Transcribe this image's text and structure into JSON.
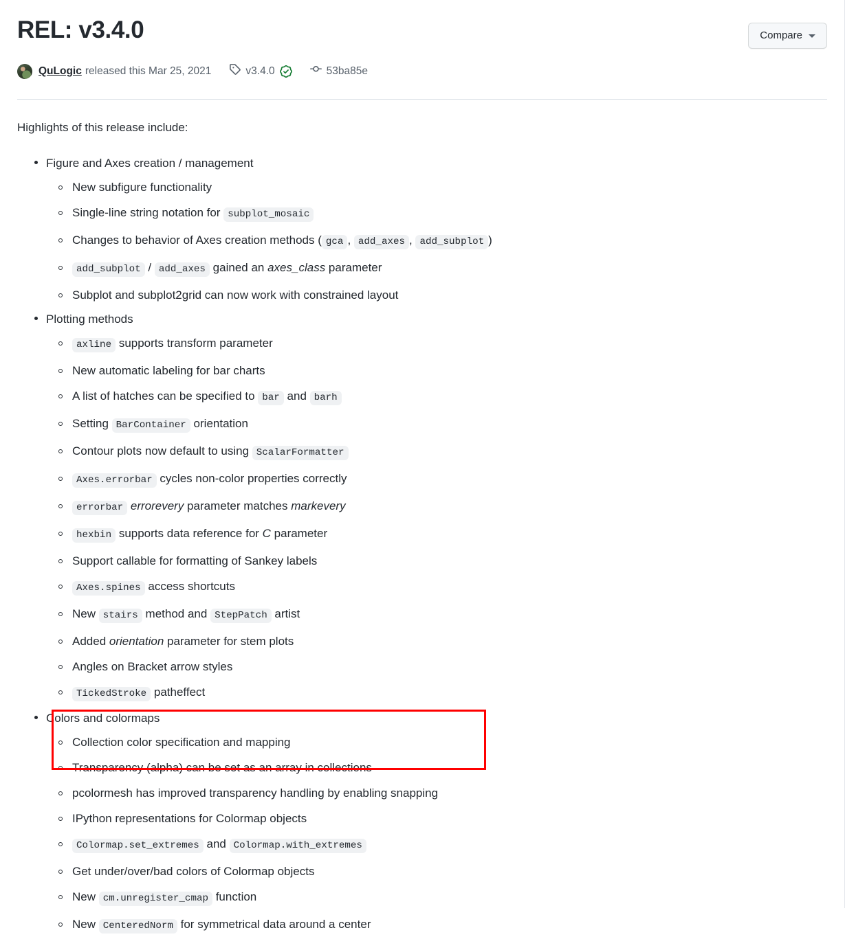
{
  "header": {
    "title": "REL: v3.4.0",
    "compare_label": "Compare",
    "caret_icon": "chevron-down-icon"
  },
  "meta": {
    "avatar_icon": "avatar",
    "author": "QuLogic",
    "released_text": "released this Mar 25, 2021",
    "tag_icon": "tag-icon",
    "tag": "v3.4.0",
    "verified_icon": "verified-badge-icon",
    "verified_color": "#1a7f37",
    "commit_icon": "git-commit-icon",
    "commit": "53ba85e"
  },
  "body": {
    "intro": "Highlights of this release include:",
    "groups": [
      {
        "title": "Figure and Axes creation / management",
        "highlighted": false,
        "items": [
          [
            {
              "t": "text",
              "v": "New subfigure functionality"
            }
          ],
          [
            {
              "t": "text",
              "v": "Single-line string notation for "
            },
            {
              "t": "code",
              "v": "subplot_mosaic"
            }
          ],
          [
            {
              "t": "text",
              "v": "Changes to behavior of Axes creation methods ("
            },
            {
              "t": "code",
              "v": "gca"
            },
            {
              "t": "text",
              "v": ", "
            },
            {
              "t": "code",
              "v": "add_axes"
            },
            {
              "t": "text",
              "v": ", "
            },
            {
              "t": "code",
              "v": "add_subplot"
            },
            {
              "t": "text",
              "v": ")"
            }
          ],
          [
            {
              "t": "code",
              "v": "add_subplot"
            },
            {
              "t": "text",
              "v": " / "
            },
            {
              "t": "code",
              "v": "add_axes"
            },
            {
              "t": "text",
              "v": " gained an "
            },
            {
              "t": "em",
              "v": "axes_class"
            },
            {
              "t": "text",
              "v": " parameter"
            }
          ],
          [
            {
              "t": "text",
              "v": "Subplot and subplot2grid can now work with constrained layout"
            }
          ]
        ]
      },
      {
        "title": "Plotting methods",
        "highlighted": false,
        "items": [
          [
            {
              "t": "code",
              "v": "axline"
            },
            {
              "t": "text",
              "v": " supports transform parameter"
            }
          ],
          [
            {
              "t": "text",
              "v": "New automatic labeling for bar charts"
            }
          ],
          [
            {
              "t": "text",
              "v": "A list of hatches can be specified to "
            },
            {
              "t": "code",
              "v": "bar"
            },
            {
              "t": "text",
              "v": " and "
            },
            {
              "t": "code",
              "v": "barh"
            }
          ],
          [
            {
              "t": "text",
              "v": "Setting "
            },
            {
              "t": "code",
              "v": "BarContainer"
            },
            {
              "t": "text",
              "v": " orientation"
            }
          ],
          [
            {
              "t": "text",
              "v": "Contour plots now default to using "
            },
            {
              "t": "code",
              "v": "ScalarFormatter"
            }
          ],
          [
            {
              "t": "code",
              "v": "Axes.errorbar"
            },
            {
              "t": "text",
              "v": " cycles non-color properties correctly"
            }
          ],
          [
            {
              "t": "code",
              "v": "errorbar"
            },
            {
              "t": "text",
              "v": " "
            },
            {
              "t": "em",
              "v": "errorevery"
            },
            {
              "t": "text",
              "v": " parameter matches "
            },
            {
              "t": "em",
              "v": "markevery"
            }
          ],
          [
            {
              "t": "code",
              "v": "hexbin"
            },
            {
              "t": "text",
              "v": " supports data reference for "
            },
            {
              "t": "em",
              "v": "C"
            },
            {
              "t": "text",
              "v": " parameter"
            }
          ],
          [
            {
              "t": "text",
              "v": "Support callable for formatting of Sankey labels"
            }
          ],
          [
            {
              "t": "code",
              "v": "Axes.spines"
            },
            {
              "t": "text",
              "v": " access shortcuts"
            }
          ],
          [
            {
              "t": "text",
              "v": "New "
            },
            {
              "t": "code",
              "v": "stairs"
            },
            {
              "t": "text",
              "v": " method and "
            },
            {
              "t": "code",
              "v": "StepPatch"
            },
            {
              "t": "text",
              "v": " artist"
            }
          ],
          [
            {
              "t": "text",
              "v": "Added "
            },
            {
              "t": "em",
              "v": "orientation"
            },
            {
              "t": "text",
              "v": " parameter for stem plots"
            }
          ],
          [
            {
              "t": "text",
              "v": "Angles on Bracket arrow styles"
            }
          ],
          [
            {
              "t": "code",
              "v": "TickedStroke"
            },
            {
              "t": "text",
              "v": " patheffect"
            }
          ]
        ]
      },
      {
        "title": "Colors and colormaps",
        "highlighted": true,
        "items": [
          [
            {
              "t": "text",
              "v": "Collection color specification and mapping"
            }
          ],
          [
            {
              "t": "text",
              "v": "Transparency (alpha) can be set as an array in collections"
            }
          ],
          [
            {
              "t": "text",
              "v": "pcolormesh has improved transparency handling by enabling snapping"
            }
          ],
          [
            {
              "t": "text",
              "v": "IPython representations for Colormap objects"
            }
          ],
          [
            {
              "t": "code",
              "v": "Colormap.set_extremes"
            },
            {
              "t": "text",
              "v": " and "
            },
            {
              "t": "code",
              "v": "Colormap.with_extremes"
            }
          ],
          [
            {
              "t": "text",
              "v": "Get under/over/bad colors of Colormap objects"
            }
          ],
          [
            {
              "t": "text",
              "v": "New "
            },
            {
              "t": "code",
              "v": "cm.unregister_cmap"
            },
            {
              "t": "text",
              "v": " function"
            }
          ],
          [
            {
              "t": "text",
              "v": "New "
            },
            {
              "t": "code",
              "v": "CenteredNorm"
            },
            {
              "t": "text",
              "v": " for symmetrical data around a center"
            }
          ]
        ]
      }
    ]
  },
  "annotation": {
    "highlight_color": "#ff0000"
  }
}
